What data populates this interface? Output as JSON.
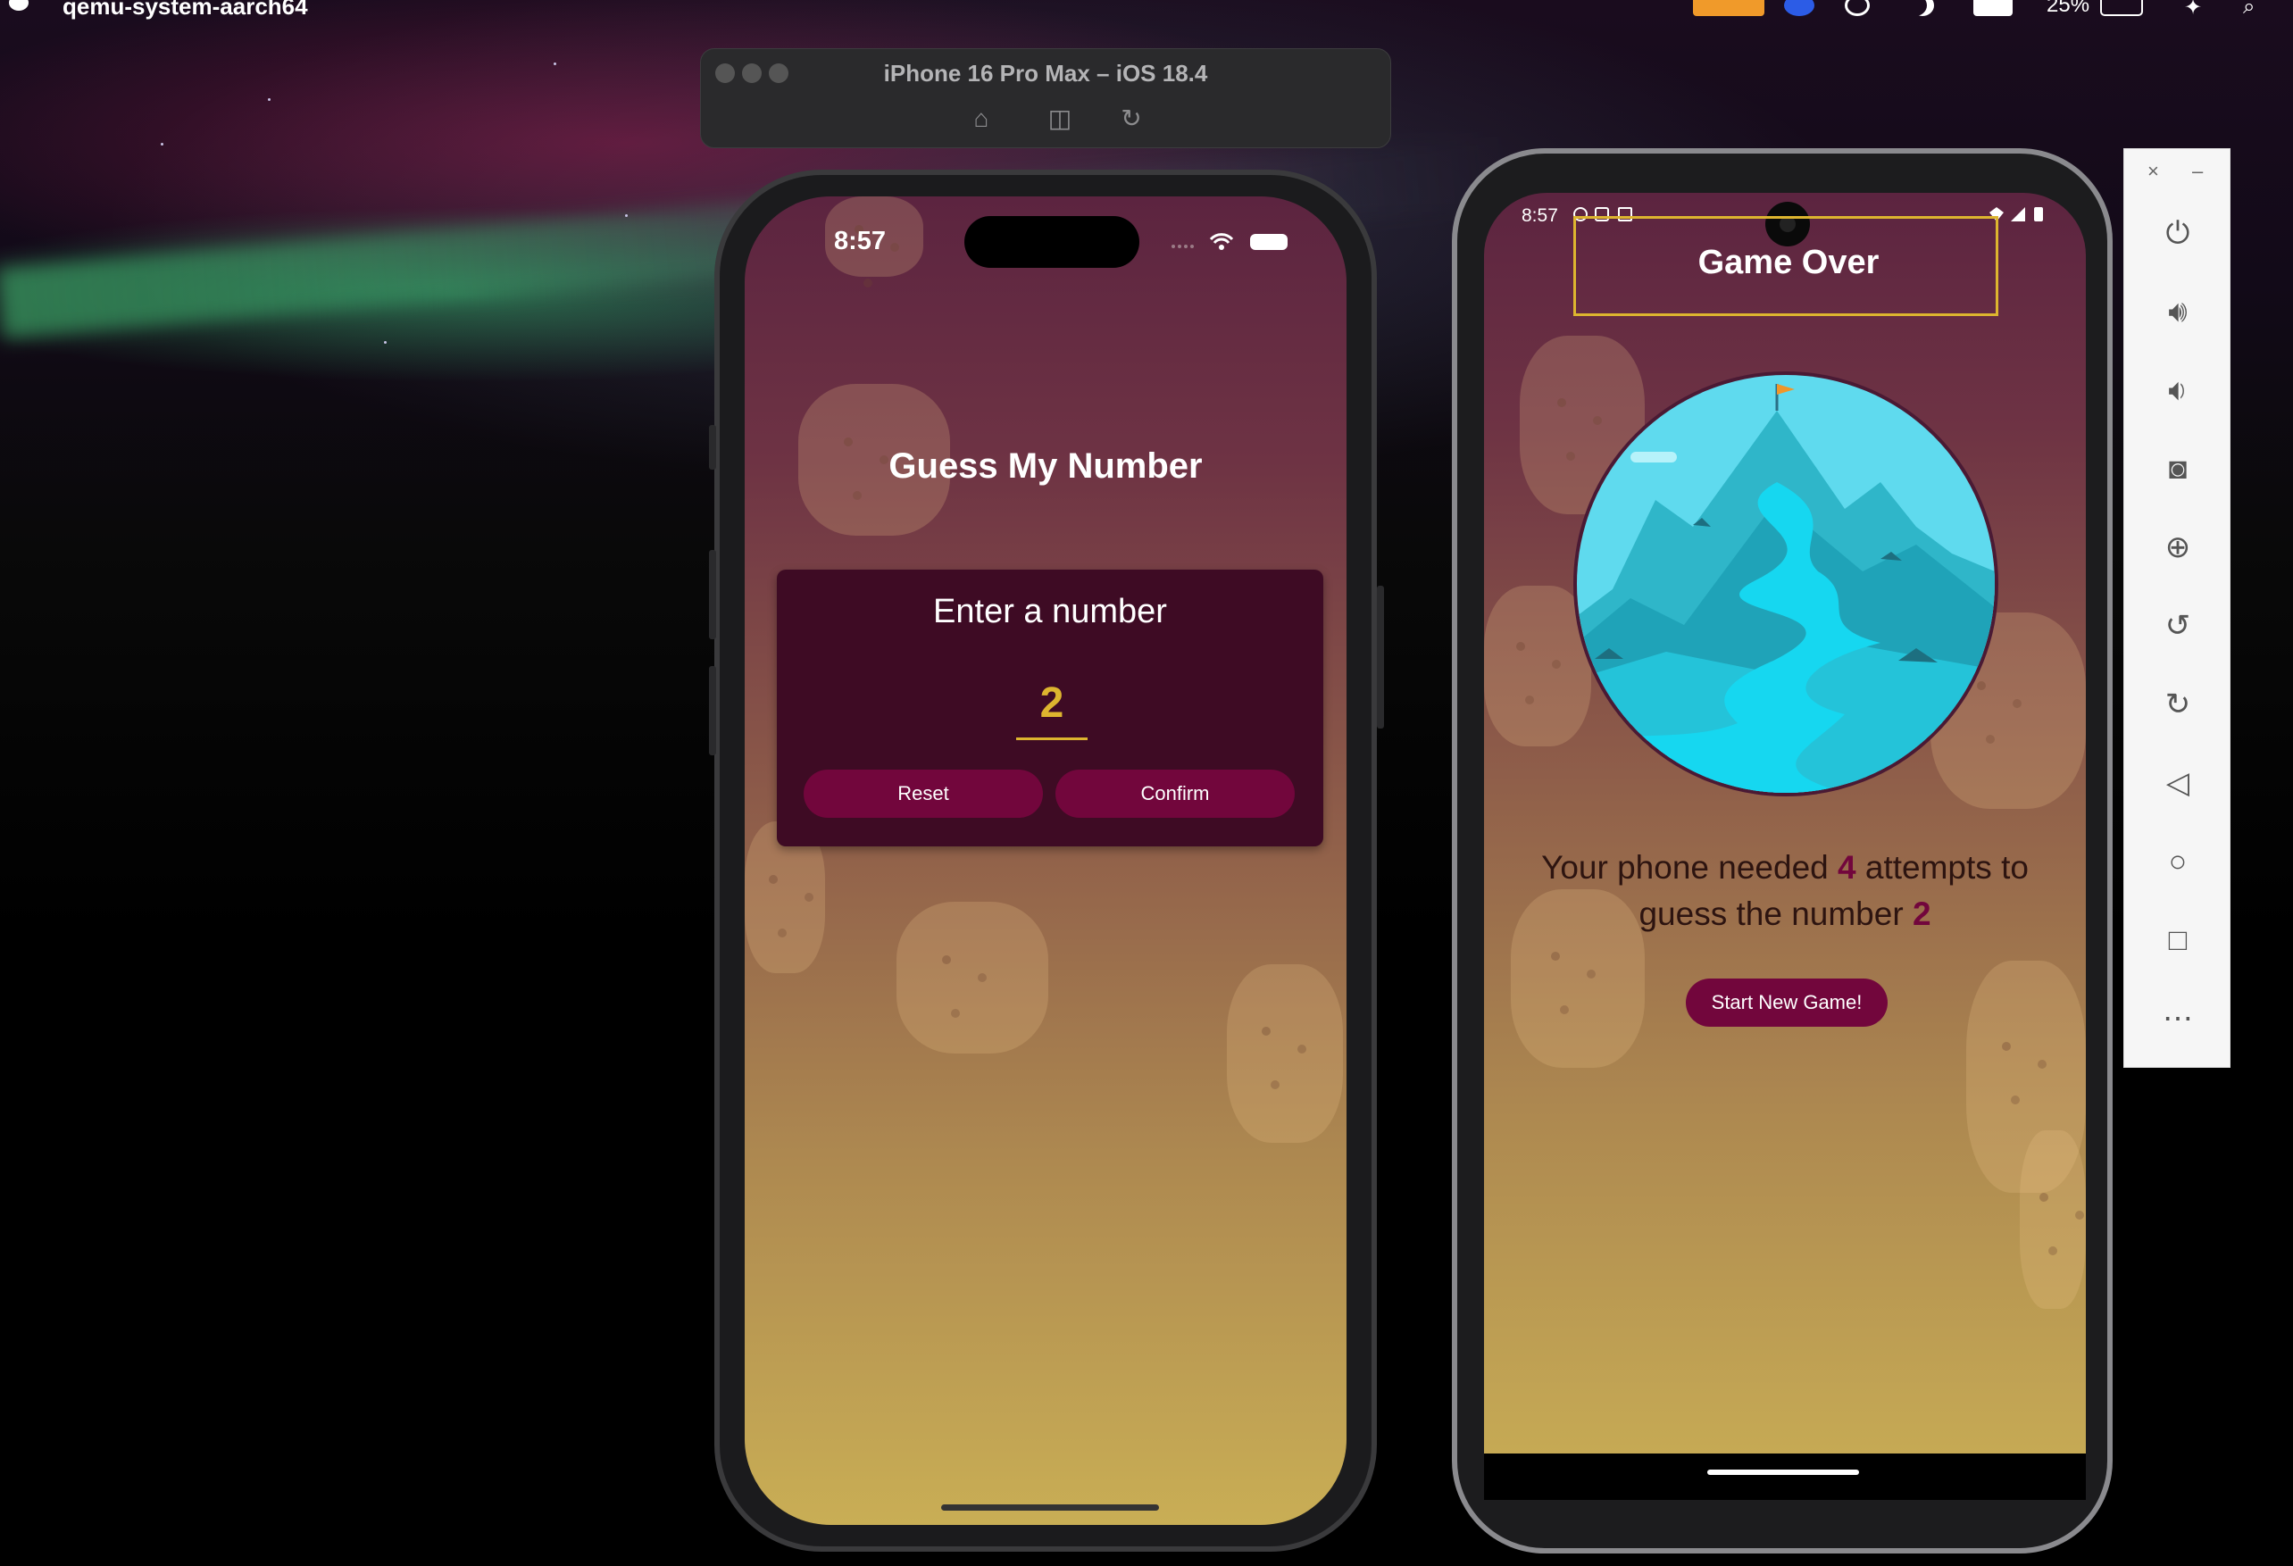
{
  "menubar": {
    "app_name": "qemu-system-aarch64",
    "battery": "25%"
  },
  "simulator_window": {
    "title": "iPhone 16 Pro Max – iOS 18.4",
    "tools": [
      "home-icon",
      "screenshot-icon",
      "rotate-icon"
    ]
  },
  "ios_app": {
    "status_time": "8:57",
    "title": "Guess My Number",
    "card_label": "Enter a number",
    "input_value": "2",
    "reset_label": "Reset",
    "confirm_label": "Confirm"
  },
  "android_app": {
    "status_time": "8:57",
    "game_over_title": "Game Over",
    "summary_prefix": "Your phone needed",
    "rounds": "4",
    "summary_middle": "attempts to guess the number",
    "user_number": "2",
    "start_button": "Start New Game!"
  },
  "emulator_controls": {
    "close": "×",
    "minimize": "–",
    "buttons": [
      "power-icon",
      "volume-up-icon",
      "volume-down-icon",
      "camera-icon",
      "zoom-icon",
      "rotate-left-icon",
      "rotate-right-icon",
      "back-icon",
      "home-icon",
      "overview-icon",
      "more-icon"
    ]
  },
  "colors": {
    "primary": "#72063c",
    "accent": "#ddb52f",
    "card": "#3e0b24"
  }
}
